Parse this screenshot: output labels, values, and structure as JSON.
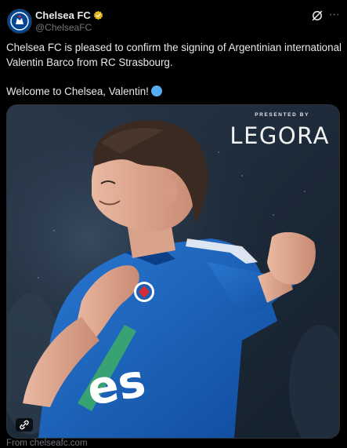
{
  "tweet": {
    "display_name": "Chelsea FC",
    "handle": "@ChelseaFC",
    "text_line1": "Chelsea FC is pleased to confirm the signing of Argentinian international Valentin Barco from RC Strasbourg.",
    "text_line2": "Welcome to Chelsea, Valentin!",
    "more_icon": "⋯"
  },
  "media": {
    "presented_by": "PRESENTED BY",
    "sponsor": "LEGORA",
    "shirt_text": "es",
    "source": "From chelseafc.com"
  },
  "icons": {
    "verified": "verified-badge-icon",
    "grok": "grok-icon",
    "more": "more-icon",
    "link": "link-icon",
    "welcome_emoji": "blue-circle-icon"
  },
  "colors": {
    "background": "#000000",
    "text": "#e7e9ea",
    "secondary": "#71767b",
    "verified_gold": "#e2b719",
    "kit_blue": "#1c5fb8"
  }
}
